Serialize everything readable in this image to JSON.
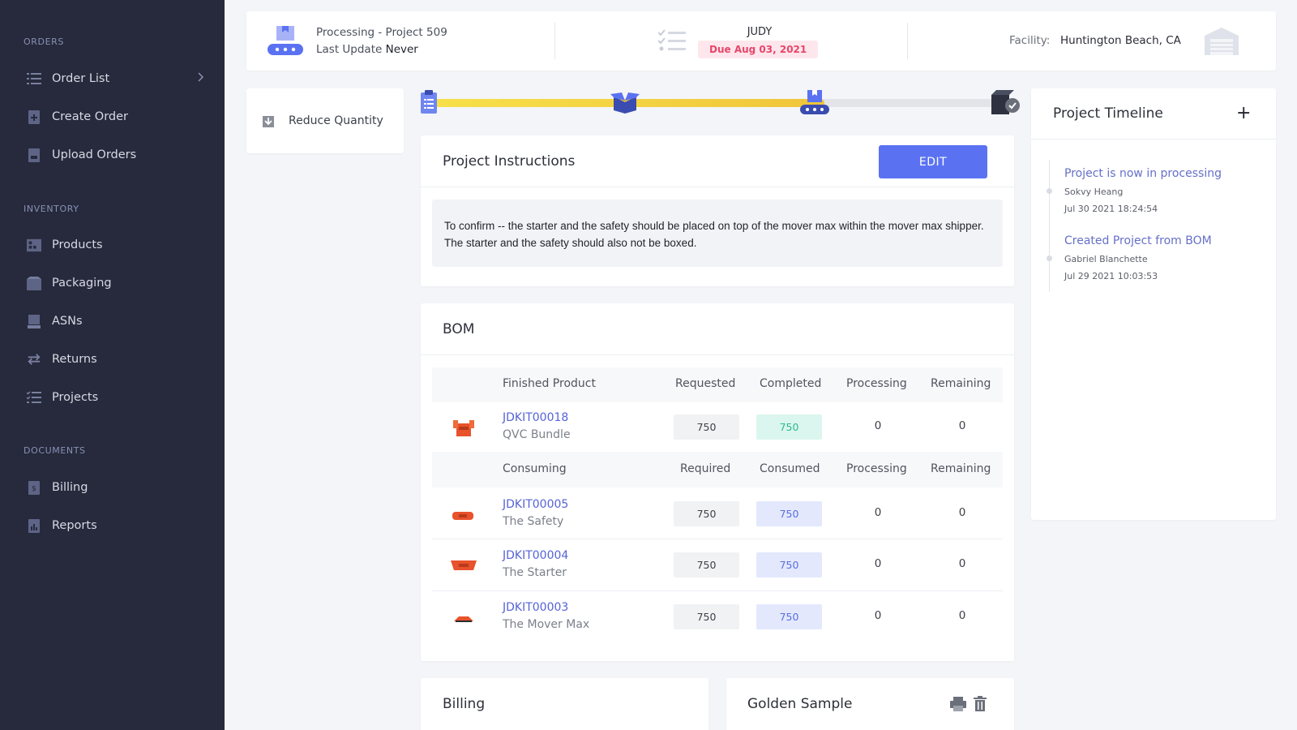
{
  "sidebar": {
    "sections": [
      {
        "label": "ORDERS"
      },
      {
        "label": "INVENTORY"
      },
      {
        "label": "DOCUMENTS"
      }
    ],
    "items": [
      {
        "label": "Order List",
        "icon": "list-icon"
      },
      {
        "label": "Create Order",
        "icon": "document-plus-icon"
      },
      {
        "label": "Upload Orders",
        "icon": "upload-document-icon"
      },
      {
        "label": "Products",
        "icon": "warehouse-shelves-icon"
      },
      {
        "label": "Packaging",
        "icon": "package-box-icon"
      },
      {
        "label": "ASNs",
        "icon": "loading-dock-icon"
      },
      {
        "label": "Returns",
        "icon": "exchange-arrows-icon"
      },
      {
        "label": "Projects",
        "icon": "checklist-icon"
      },
      {
        "label": "Billing",
        "icon": "billing-document-icon"
      },
      {
        "label": "Reports",
        "icon": "report-chart-icon"
      }
    ]
  },
  "header": {
    "status_line": "Processing - Project 509",
    "last_update_label": "Last Update",
    "last_update_value": "Never",
    "assignee": "JUDY",
    "due": "Due Aug 03, 2021",
    "facility_label": "Facility:",
    "facility_value": "Huntington Beach, CA"
  },
  "reduce_quantity": {
    "label": "Reduce Quantity"
  },
  "progress": {
    "fill_fraction": 0.69,
    "current_stage": 3,
    "stage_count": 4
  },
  "instructions": {
    "title": "Project Instructions",
    "edit_label": "EDIT",
    "text": "To confirm -- the starter and the safety should be placed on top of the mover max within the mover max shipper. The starter and the safety should also not be boxed."
  },
  "bom": {
    "title": "BOM",
    "finished_headers": [
      "Finished Product",
      "Requested",
      "Completed",
      "Processing",
      "Remaining"
    ],
    "finished": [
      {
        "sku": "JDKIT00018",
        "name": "QVC Bundle",
        "requested": "750",
        "completed": "750",
        "processing": "0",
        "remaining": "0"
      }
    ],
    "consuming_headers": [
      "Consuming",
      "Required",
      "Consumed",
      "Processing",
      "Remaining"
    ],
    "consuming": [
      {
        "sku": "JDKIT00005",
        "name": "The Safety",
        "required": "750",
        "consumed": "750",
        "processing": "0",
        "remaining": "0"
      },
      {
        "sku": "JDKIT00004",
        "name": "The Starter",
        "required": "750",
        "consumed": "750",
        "processing": "0",
        "remaining": "0"
      },
      {
        "sku": "JDKIT00003",
        "name": "The Mover Max",
        "required": "750",
        "consumed": "750",
        "processing": "0",
        "remaining": "0"
      }
    ]
  },
  "timeline": {
    "title": "Project Timeline",
    "add_label": "+",
    "events": [
      {
        "title": "Project is now in processing",
        "user": "Sokvy Heang",
        "time": "Jul 30 2021 18:24:54"
      },
      {
        "title": "Created Project from BOM",
        "user": "Gabriel Blanchette",
        "time": "Jul 29 2021 10:03:53"
      }
    ]
  },
  "billing": {
    "title": "Billing"
  },
  "golden_sample": {
    "title": "Golden Sample"
  },
  "colors": {
    "sidebar_bg": "#262a3c",
    "accent_blue": "#5a72f2",
    "progress_yellow": "#f5d23a",
    "due_red": "#e8466b",
    "completed_green": "#2dba8f"
  }
}
